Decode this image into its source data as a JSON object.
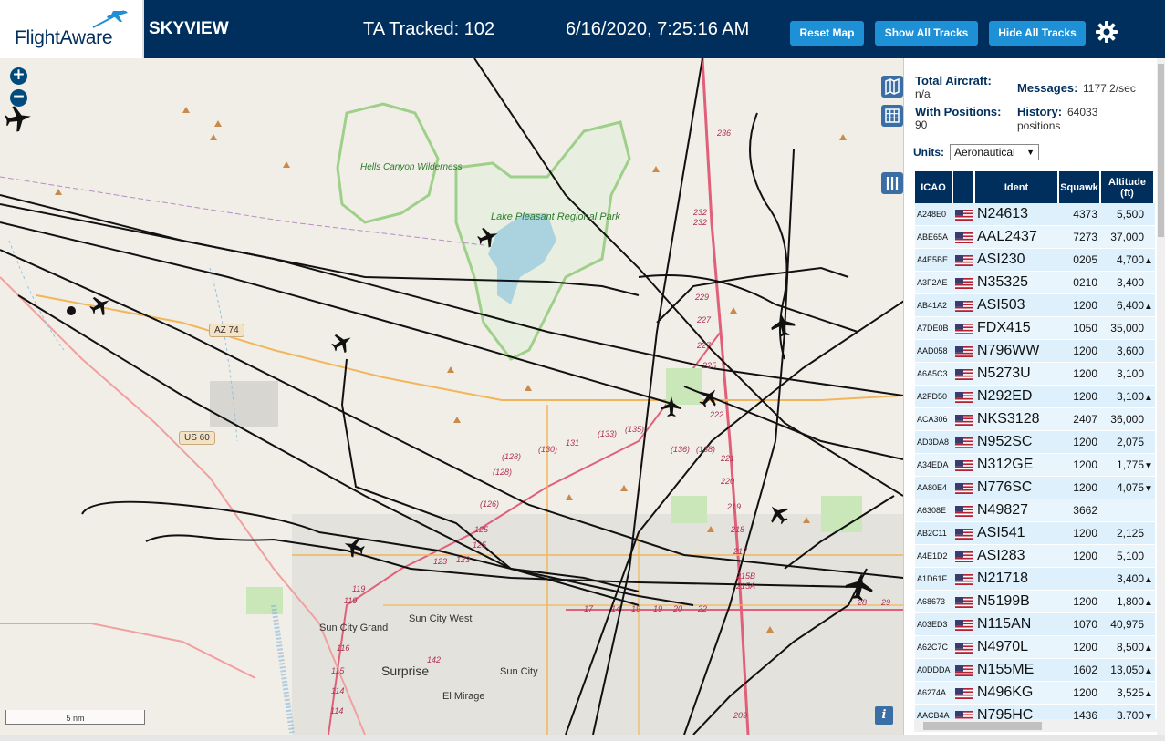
{
  "header": {
    "logo_text": "FlightAware",
    "title": "SKYVIEW",
    "tracked": "TA Tracked: 102",
    "datetime": "6/16/2020, 7:25:16 AM",
    "reset_label": "Reset Map",
    "show_label": "Show All Tracks",
    "hide_label": "Hide All Tracks",
    "settings_icon": "gear-icon"
  },
  "map": {
    "zoom_in": "+",
    "zoom_out": "−",
    "scale": "5 nm",
    "info": "i",
    "labels": {
      "hells_canyon": "Hells Canyon Wilderness",
      "lake_pleasant": "Lake Pleasant Regional Park",
      "az74": "AZ 74",
      "us60": "US 60",
      "sun_city_grand": "Sun City Grand",
      "sun_city_west": "Sun City West",
      "sun_city": "Sun City",
      "surprise": "Surprise",
      "el_mirage": "El Mirage"
    }
  },
  "sidebar": {
    "total_aircraft_label": "Total Aircraft:",
    "total_aircraft_value": "n/a",
    "with_positions_label": "With Positions:",
    "with_positions_value": "90",
    "messages_label": "Messages:",
    "messages_value": "1177.2/sec",
    "history_label": "History:",
    "history_value": "64033",
    "history_unit": "positions",
    "units_label": "Units:",
    "units_value": "Aeronautical",
    "columns": [
      "ICAO",
      "",
      "Ident",
      "Squawk",
      "Altitude (ft)"
    ],
    "rows": [
      {
        "icao": "A248E0",
        "ident": "N24613",
        "squawk": "4373",
        "alt": "5,500",
        "trend": ""
      },
      {
        "icao": "ABE65A",
        "ident": "AAL2437",
        "squawk": "7273",
        "alt": "37,000",
        "trend": ""
      },
      {
        "icao": "A4E5BE",
        "ident": "ASI230",
        "squawk": "0205",
        "alt": "4,700",
        "trend": "▲"
      },
      {
        "icao": "A3F2AE",
        "ident": "N35325",
        "squawk": "0210",
        "alt": "3,400",
        "trend": ""
      },
      {
        "icao": "AB41A2",
        "ident": "ASI503",
        "squawk": "1200",
        "alt": "6,400",
        "trend": "▲"
      },
      {
        "icao": "A7DE0B",
        "ident": "FDX415",
        "squawk": "1050",
        "alt": "35,000",
        "trend": ""
      },
      {
        "icao": "AAD058",
        "ident": "N796WW",
        "squawk": "1200",
        "alt": "3,600",
        "trend": ""
      },
      {
        "icao": "A6A5C3",
        "ident": "N5273U",
        "squawk": "1200",
        "alt": "3,100",
        "trend": ""
      },
      {
        "icao": "A2FD50",
        "ident": "N292ED",
        "squawk": "1200",
        "alt": "3,100",
        "trend": "▲"
      },
      {
        "icao": "ACA306",
        "ident": "NKS3128",
        "squawk": "2407",
        "alt": "36,000",
        "trend": ""
      },
      {
        "icao": "AD3DA8",
        "ident": "N952SC",
        "squawk": "1200",
        "alt": "2,075",
        "trend": ""
      },
      {
        "icao": "A34EDA",
        "ident": "N312GE",
        "squawk": "1200",
        "alt": "1,775",
        "trend": "▼"
      },
      {
        "icao": "AA80E4",
        "ident": "N776SC",
        "squawk": "1200",
        "alt": "4,075",
        "trend": "▼"
      },
      {
        "icao": "A6308E",
        "ident": "N49827",
        "squawk": "3662",
        "alt": "",
        "trend": ""
      },
      {
        "icao": "AB2C11",
        "ident": "ASI541",
        "squawk": "1200",
        "alt": "2,125",
        "trend": ""
      },
      {
        "icao": "A4E1D2",
        "ident": "ASI283",
        "squawk": "1200",
        "alt": "5,100",
        "trend": ""
      },
      {
        "icao": "A1D61F",
        "ident": "N21718",
        "squawk": "",
        "alt": "3,400",
        "trend": "▲"
      },
      {
        "icao": "A68673",
        "ident": "N5199B",
        "squawk": "1200",
        "alt": "1,800",
        "trend": "▲"
      },
      {
        "icao": "A03ED3",
        "ident": "N115AN",
        "squawk": "1070",
        "alt": "40,975",
        "trend": ""
      },
      {
        "icao": "A62C7C",
        "ident": "N4970L",
        "squawk": "1200",
        "alt": "8,500",
        "trend": "▲"
      },
      {
        "icao": "A0DDDA",
        "ident": "N155ME",
        "squawk": "1602",
        "alt": "13,050",
        "trend": "▲"
      },
      {
        "icao": "A6274A",
        "ident": "N496KG",
        "squawk": "1200",
        "alt": "3,525",
        "trend": "▲"
      },
      {
        "icao": "AACB4A",
        "ident": "N795HC",
        "squawk": "1436",
        "alt": "3,700",
        "trend": "▼"
      }
    ]
  },
  "colors": {
    "header_bg": "#002f5d",
    "button_bg": "#1e90d6",
    "row_bg": "#ddf0fb",
    "track": "#111111",
    "highway": "#e0607a",
    "major_road": "#f2b65a"
  }
}
